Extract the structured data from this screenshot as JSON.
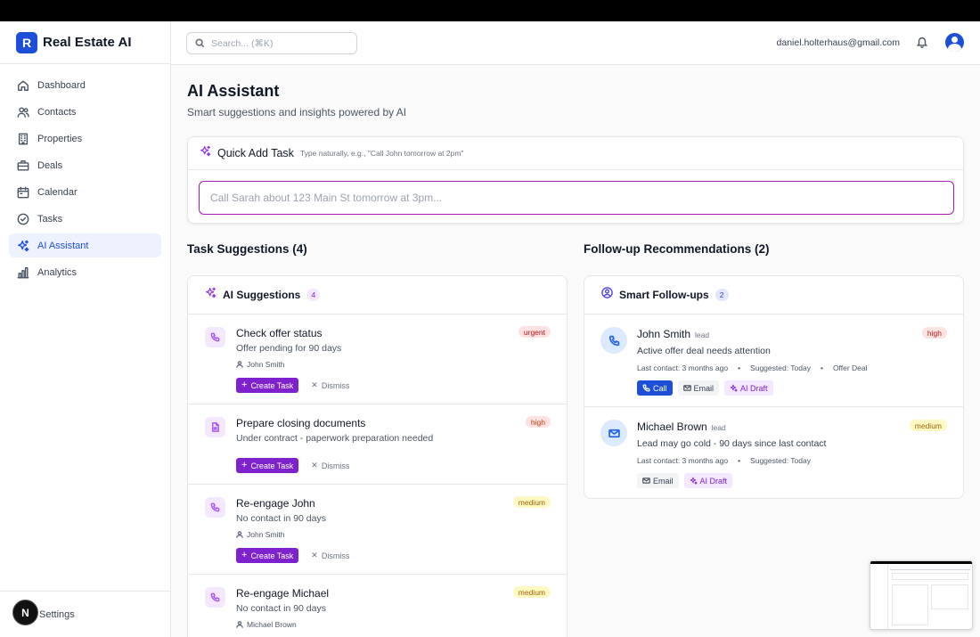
{
  "app": {
    "logo_letter": "R",
    "name": "Real Estate AI"
  },
  "sidebar": {
    "items": [
      {
        "label": "Dashboard",
        "icon": "home-icon"
      },
      {
        "label": "Contacts",
        "icon": "users-icon"
      },
      {
        "label": "Properties",
        "icon": "building-icon"
      },
      {
        "label": "Deals",
        "icon": "briefcase-icon"
      },
      {
        "label": "Calendar",
        "icon": "calendar-icon"
      },
      {
        "label": "Tasks",
        "icon": "check-circle-icon"
      },
      {
        "label": "AI Assistant",
        "icon": "sparkles-icon",
        "active": true
      },
      {
        "label": "Analytics",
        "icon": "bar-chart-icon"
      }
    ],
    "footer_label": "Settings",
    "footer_badge": "N"
  },
  "header": {
    "search_placeholder": "Search... (⌘K)",
    "user_email": "daniel.holterhaus@gmail.com"
  },
  "page": {
    "title": "AI Assistant",
    "subtitle": "Smart suggestions and insights powered by AI"
  },
  "quick_add": {
    "title": "Quick Add Task",
    "hint": "Type naturally, e.g., \"Call John tomorrow at 2pm\"",
    "placeholder": "Call Sarah about 123 Main St tomorrow at 3pm..."
  },
  "task_suggestions": {
    "section_title": "Task Suggestions (4)",
    "panel_title": "AI Suggestions",
    "count": "4",
    "create_label": "Create Task",
    "dismiss_label": "Dismiss",
    "items": [
      {
        "icon": "phone-icon",
        "title": "Check offer status",
        "description": "Offer pending for 90 days",
        "contact": "John Smith",
        "priority": "urgent"
      },
      {
        "icon": "document-icon",
        "title": "Prepare closing documents",
        "description": "Under contract - paperwork preparation needed",
        "contact": "",
        "priority": "high"
      },
      {
        "icon": "phone-icon",
        "title": "Re-engage John",
        "description": "No contact in 90 days",
        "contact": "John Smith",
        "priority": "medium"
      },
      {
        "icon": "phone-icon",
        "title": "Re-engage Michael",
        "description": "No contact in 90 days",
        "contact": "Michael Brown",
        "priority": "medium"
      }
    ]
  },
  "follow_ups": {
    "section_title": "Follow-up Recommendations (2)",
    "panel_title": "Smart Follow-ups",
    "count": "2",
    "items": [
      {
        "icon": "phone-icon",
        "name": "John Smith",
        "tag": "lead",
        "priority": "high",
        "reason": "Active offer deal needs attention",
        "last_contact": "Last contact: 3 months ago",
        "suggested": "Suggested: Today",
        "extra": "Offer Deal",
        "actions": [
          "Call",
          "Email",
          "AI Draft"
        ]
      },
      {
        "icon": "mail-icon",
        "name": "Michael Brown",
        "tag": "lead",
        "priority": "medium",
        "reason": "Lead may go cold - 90 days since last contact",
        "last_contact": "Last contact: 3 months ago",
        "suggested": "Suggested: Today",
        "actions": [
          "Email",
          "AI Draft"
        ]
      }
    ]
  },
  "colors": {
    "primary": "#1d4ed8",
    "accent": "#7e22ce",
    "active_nav_bg": "#eef2ff"
  }
}
